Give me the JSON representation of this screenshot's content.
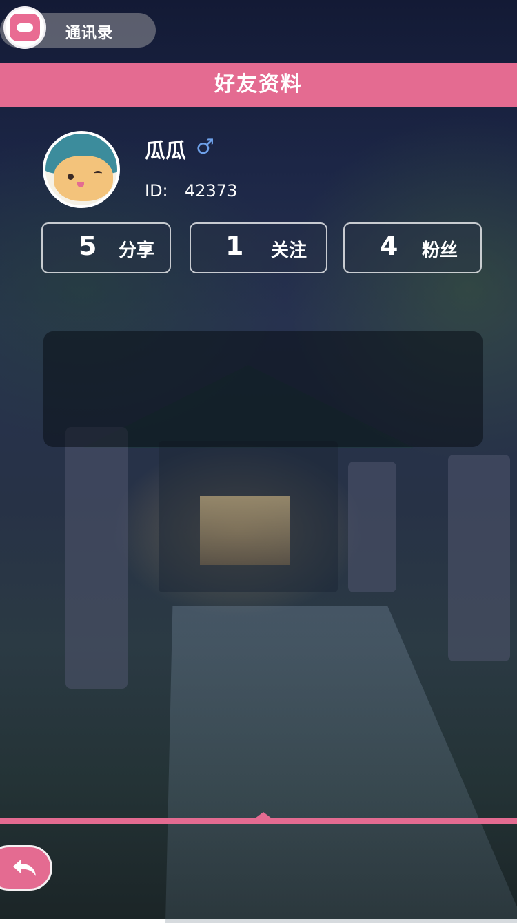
{
  "top": {
    "contacts_label": "通讯录",
    "icon": "contacts-icon"
  },
  "header": {
    "title": "好友资料"
  },
  "profile": {
    "name": "瓜瓜",
    "gender_symbol": "♂",
    "id_label": "ID:",
    "id_value": "42373",
    "avatar_icon": "cat-avatar"
  },
  "stats": [
    {
      "count": "5",
      "label": "分享"
    },
    {
      "count": "1",
      "label": "关注"
    },
    {
      "count": "4",
      "label": "粉丝"
    }
  ],
  "bio": {
    "text": ""
  },
  "footer": {
    "back_icon": "back-arrow-icon"
  },
  "colors": {
    "accent": "#e46b91",
    "gender_male": "#6ea0e8"
  }
}
